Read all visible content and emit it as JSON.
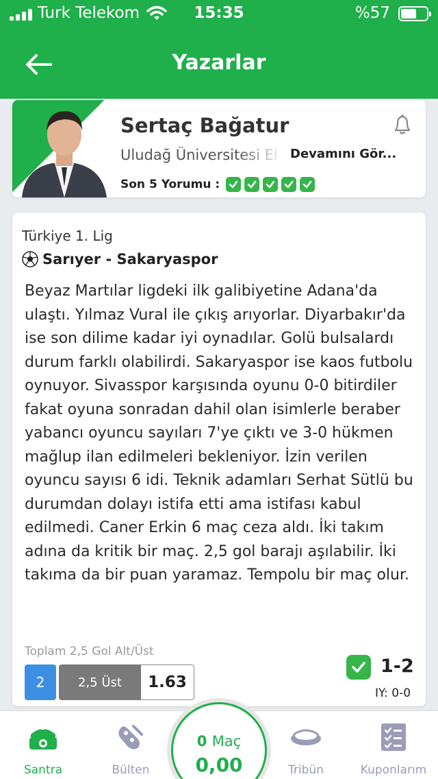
{
  "status_bar": {
    "carrier": "Turk Telekom",
    "time": "15:35",
    "battery": "%57"
  },
  "header": {
    "title": "Yazarlar"
  },
  "author": {
    "name": "Sertaç Bağatur",
    "description": "Uludağ Üniversitesi El",
    "more_label": "Devamını Gör...",
    "last5_label": "Son 5 Yorumu :",
    "last5_results": [
      "won",
      "won",
      "won",
      "won",
      "won"
    ]
  },
  "comment": {
    "league": "Türkiye 1. Lig",
    "match": "Sarıyer - Sakaryaspor",
    "text": "Beyaz Martılar ligdeki ilk galibiyetine Adana'da ulaştı. Yılmaz Vural ile çıkış arıyorlar. Diyarbakır'da ise son dilime kadar iyi oynadılar. Golü bulsalardı durum farklı olabilirdi. Sakaryaspor ise kaos futbolu oynuyor. Sivasspor karşısında oyunu 0-0 bitirdiler fakat oyuna sonradan dahil olan isimlerle beraber yabancı oyuncu sayıları 7'ye çıktı ve 3-0 hükmen mağlup ilan edilmeleri bekleniyor. İzin verilen oyuncu sayısı 6 idi. Teknik adamları Serhat Sütlü bu durumdan dolayı istifa etti ama istifası kabul edilmedi. Caner Erkin 6 maç ceza aldı. İki takım adına da kritik bir maç. 2,5 gol barajı aşılabilir. İki takıma da bir puan yaramaz. Tempolu bir maç olur.",
    "bet_type": "Toplam 2,5 Gol Alt/Üst",
    "bet_number": "2",
    "bet_selection": "2,5 Üst",
    "bet_odd": "1.63",
    "score": "1-2",
    "half_time": "IY: 0-0"
  },
  "nav": {
    "items": [
      {
        "label": "Santra",
        "icon": "whistle-icon",
        "active": true
      },
      {
        "label": "Bülten",
        "icon": "bulletin-icon",
        "active": false
      },
      {
        "label": "Tribün",
        "icon": "stadium-icon",
        "active": false
      },
      {
        "label": "Kuponlarım",
        "icon": "coupon-list-icon",
        "active": false
      }
    ],
    "coupon": {
      "count": "0",
      "count_unit": "Maç",
      "amount": "0,00"
    }
  },
  "colors": {
    "brand_green": "#1faf4b",
    "check_green": "#35b54a",
    "bet_blue": "#3d8fe3",
    "nav_inactive": "#9a9cb8"
  }
}
